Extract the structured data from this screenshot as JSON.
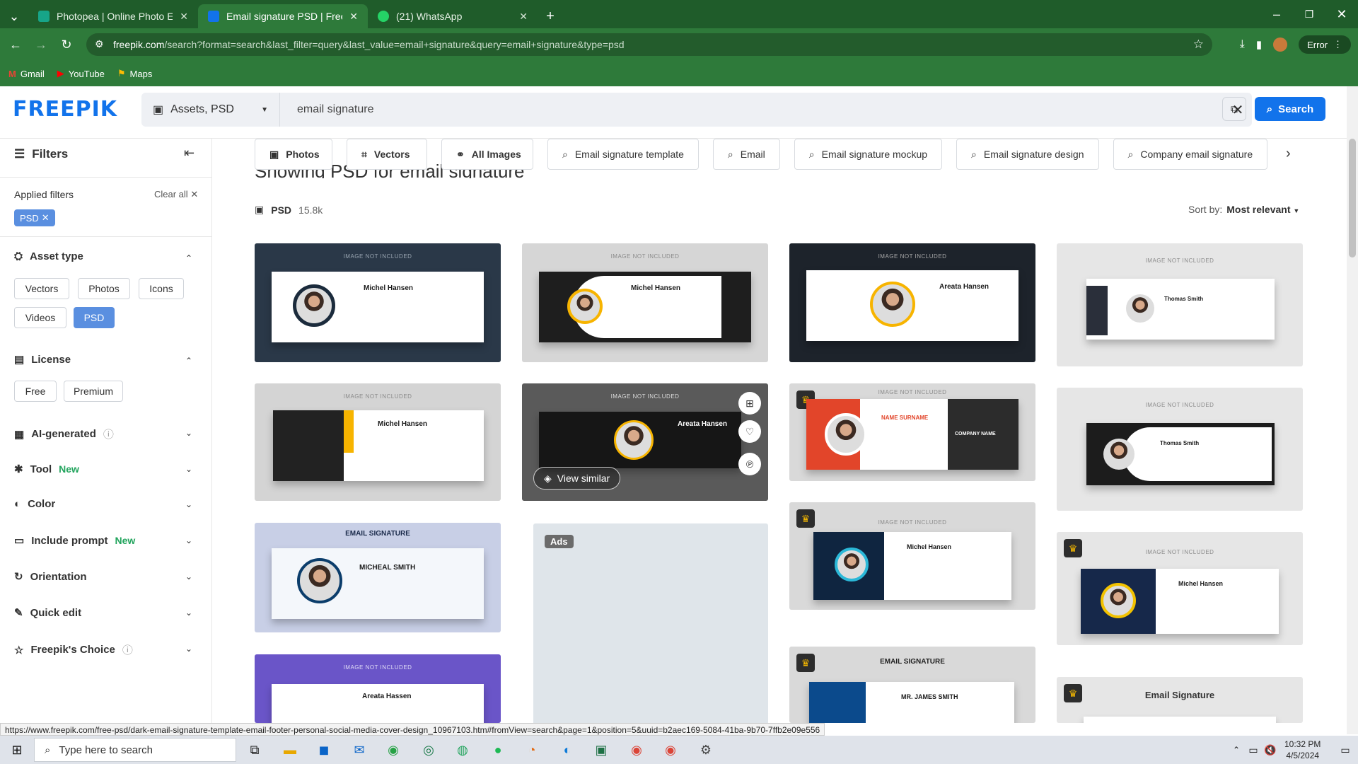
{
  "browser": {
    "tabs": [
      {
        "title": "Photopea | Online Photo Editor",
        "active": false
      },
      {
        "title": "Email signature PSD | Free dow",
        "active": true
      },
      {
        "title": "(21) WhatsApp",
        "active": false
      }
    ],
    "url_host": "freepik.com",
    "url_path": "/search?format=search&last_filter=query&last_value=email+signature&query=email+signature&type=psd",
    "bookmarks": [
      "Gmail",
      "YouTube",
      "Maps"
    ],
    "profile_status": "Error"
  },
  "header": {
    "logo": "FREEPIK",
    "asset_select": "Assets, PSD",
    "query": "email signature",
    "search_label": "Search"
  },
  "sidebar": {
    "title": "Filters",
    "applied_label": "Applied filters",
    "clear_all": "Clear all",
    "active_chip": "PSD",
    "asset_type": {
      "label": "Asset type",
      "options": [
        "Vectors",
        "Photos",
        "Icons",
        "Videos",
        "PSD"
      ]
    },
    "license": {
      "label": "License",
      "options": [
        "Free",
        "Premium"
      ]
    },
    "sections": [
      {
        "label": "AI-generated",
        "badge": ""
      },
      {
        "label": "Tool",
        "badge": "New"
      },
      {
        "label": "Color",
        "badge": ""
      },
      {
        "label": "Include prompt",
        "badge": "New"
      },
      {
        "label": "Orientation",
        "badge": ""
      },
      {
        "label": "Quick edit",
        "badge": ""
      },
      {
        "label": "Freepik's Choice",
        "badge": ""
      }
    ]
  },
  "pills": [
    "Photos",
    "Vectors",
    "All Images",
    "Email signature template",
    "Email",
    "Email signature mockup",
    "Email signature design",
    "Company email signature"
  ],
  "results": {
    "clipped_heading": "Showing PSD for email signature",
    "type_label": "PSD",
    "count": "15.8k",
    "sort_label": "Sort by:",
    "sort_value": "Most relevant"
  },
  "cards": {
    "not_included": "IMAGE NOT INCLUDED",
    "names": [
      "Michel Hansen",
      "Michel Hansen",
      "Areata Hansen",
      "Thomas Smith",
      "Michel Hansen",
      "Areata Hansen",
      "NAME SURNAME",
      "Thomas Smith",
      "MICHEAL SMITH",
      "Michel Hansen",
      "Michel Hansen",
      "Areata Hassen",
      "MR. JAMES SMITH"
    ],
    "titles": [
      "EMAIL SIGNATURE",
      "EMAIL SIGNATURE",
      "Email Signature"
    ],
    "company": "COMPANY NAME",
    "view_similar": "View similar",
    "ads_label": "Ads"
  },
  "status_url": "https://www.freepik.com/free-psd/dark-email-signature-template-email-footer-personal-social-media-cover-design_10967103.htm#fromView=search&page=1&position=5&uuid=b2aec169-5084-41ba-9b70-7ffb2e09e556",
  "taskbar": {
    "search_placeholder": "Type here to search",
    "time": "10:32 PM",
    "date": "4/5/2024"
  },
  "colors": {
    "brand": "#1273eb",
    "browser_frame": "#2e7a3a",
    "new_badge": "#22a45d"
  }
}
